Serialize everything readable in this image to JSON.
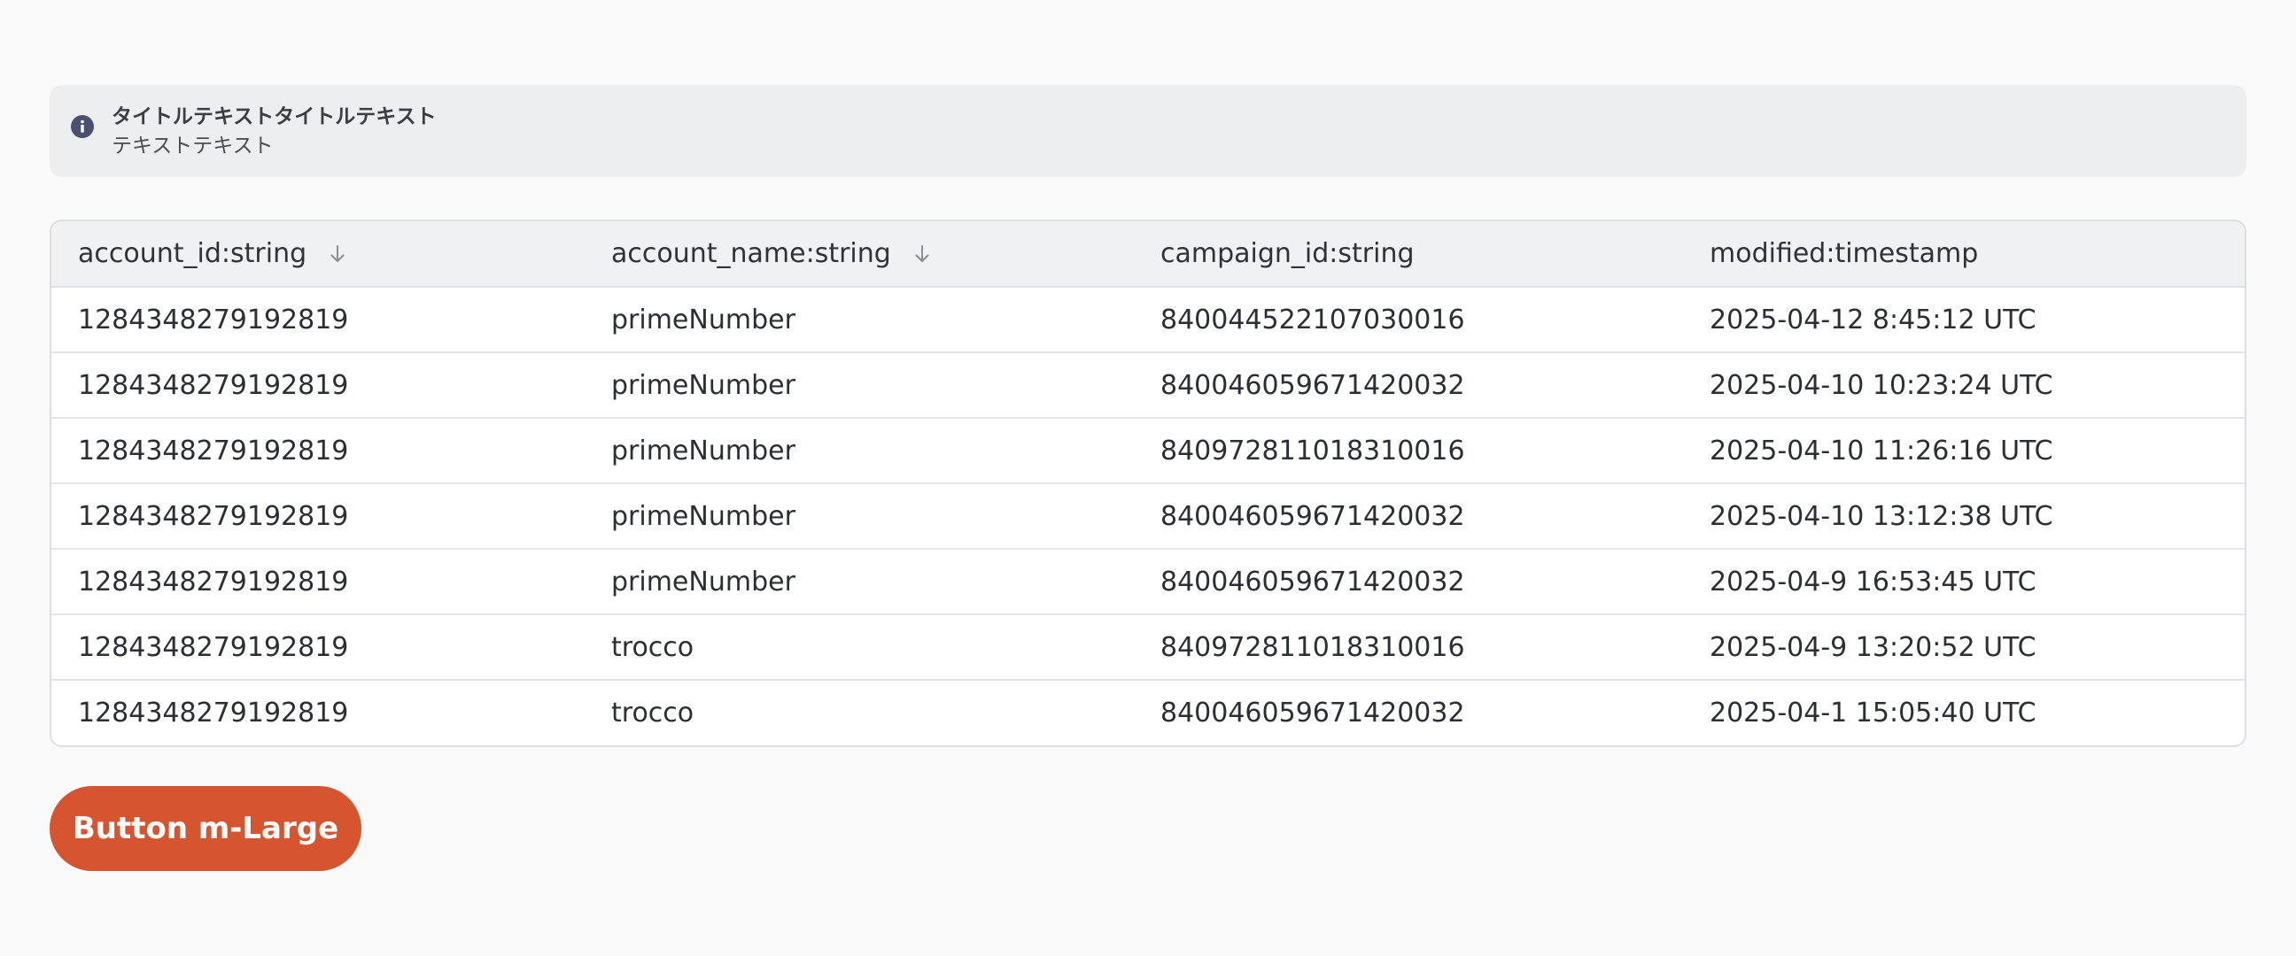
{
  "alert": {
    "title": "タイトルテキストタイトルテキスト",
    "text": "テキストテキスト",
    "icon": "info-icon",
    "icon_color": "#4a5170"
  },
  "table": {
    "columns": [
      {
        "label": "account_id:string",
        "sortable": true
      },
      {
        "label": "account_name:string",
        "sortable": true
      },
      {
        "label": "campaign_id:string",
        "sortable": false
      },
      {
        "label": "modified:timestamp",
        "sortable": false
      }
    ],
    "rows": [
      [
        "1284348279192819",
        "primeNumber",
        "840044522107030016",
        "2025-04-12 8:45:12 UTC"
      ],
      [
        "1284348279192819",
        "primeNumber",
        "840046059671420032",
        "2025-04-10 10:23:24 UTC"
      ],
      [
        "1284348279192819",
        "primeNumber",
        "840972811018310016",
        "2025-04-10 11:26:16 UTC"
      ],
      [
        "1284348279192819",
        "primeNumber",
        "840046059671420032",
        "2025-04-10 13:12:38 UTC"
      ],
      [
        "1284348279192819",
        "primeNumber",
        "840046059671420032",
        "2025-04-9 16:53:45 UTC"
      ],
      [
        "1284348279192819",
        "trocco",
        "840972811018310016",
        "2025-04-9 13:20:52 UTC"
      ],
      [
        "1284348279192819",
        "trocco",
        "840046059671420032",
        "2025-04-1 15:05:40 UTC"
      ]
    ]
  },
  "button": {
    "label": "Button m-Large",
    "color": "#d4552f"
  }
}
